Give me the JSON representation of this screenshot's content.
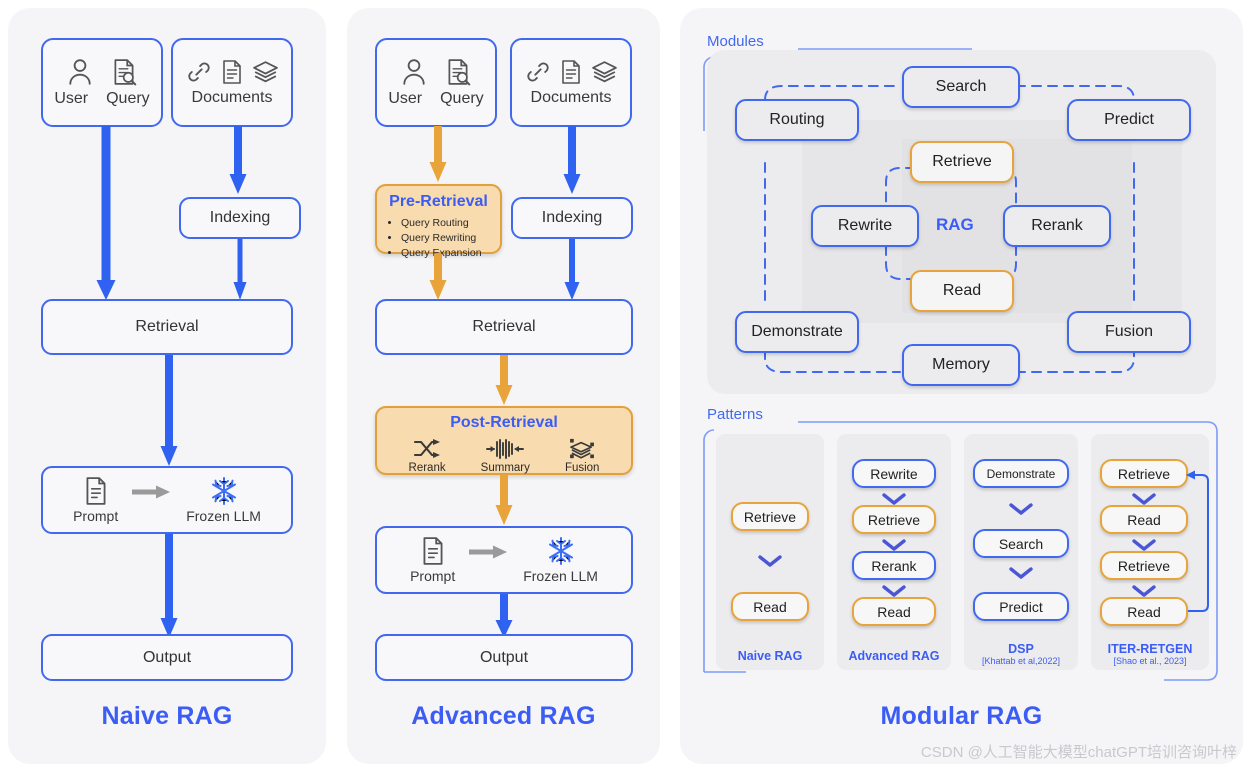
{
  "naive": {
    "title": "Naive RAG",
    "user_query": {
      "user": "User",
      "query": "Query"
    },
    "documents": "Documents",
    "indexing": "Indexing",
    "retrieval": "Retrieval",
    "prompt": "Prompt",
    "frozen_llm": "Frozen LLM",
    "output": "Output"
  },
  "advanced": {
    "title": "Advanced RAG",
    "user_query": {
      "user": "User",
      "query": "Query"
    },
    "documents": "Documents",
    "indexing": "Indexing",
    "pre_retrieval": {
      "header": "Pre-Retrieval",
      "items": [
        "Query Routing",
        "Query Rewriting",
        "Query Expansion"
      ]
    },
    "retrieval": "Retrieval",
    "post_retrieval": {
      "header": "Post-Retrieval",
      "items": [
        "Rerank",
        "Summary",
        "Fusion"
      ]
    },
    "prompt": "Prompt",
    "frozen_llm": "Frozen LLM",
    "output": "Output"
  },
  "modular": {
    "title": "Modular RAG",
    "modules_label": "Modules",
    "patterns_label": "Patterns",
    "rag_core_label": "RAG",
    "modules": {
      "search": "Search",
      "routing": "Routing",
      "predict": "Predict",
      "retrieve": "Retrieve",
      "rewrite": "Rewrite",
      "rerank": "Rerank",
      "read": "Read",
      "demonstrate": "Demonstrate",
      "fusion": "Fusion",
      "memory": "Memory"
    },
    "patterns": [
      {
        "name": "Naive RAG",
        "citation": "",
        "steps": [
          {
            "label": "Retrieve",
            "color": "orange"
          },
          {
            "label": "Read",
            "color": "orange"
          }
        ]
      },
      {
        "name": "Advanced RAG",
        "citation": "",
        "steps": [
          {
            "label": "Rewrite",
            "color": "blue"
          },
          {
            "label": "Retrieve",
            "color": "orange"
          },
          {
            "label": "Rerank",
            "color": "blue"
          },
          {
            "label": "Read",
            "color": "orange"
          }
        ]
      },
      {
        "name": "DSP",
        "citation": "[Khattab et al,2022]",
        "steps": [
          {
            "label": "Demonstrate",
            "color": "blue"
          },
          {
            "label": "Search",
            "color": "blue"
          },
          {
            "label": "Predict",
            "color": "blue"
          }
        ]
      },
      {
        "name": "ITER-RETGEN",
        "citation": "[Shao et al., 2023]",
        "steps": [
          {
            "label": "Retrieve",
            "color": "orange"
          },
          {
            "label": "Read",
            "color": "orange"
          },
          {
            "label": "Retrieve",
            "color": "orange"
          },
          {
            "label": "Read",
            "color": "orange"
          }
        ]
      }
    ]
  },
  "watermark": "CSDN @人工智能大模型chatGPT培训咨询叶梓",
  "colors": {
    "blue": "#3b5cf5",
    "border_blue": "#4169f0",
    "orange": "#e8a33d",
    "pre_retrieval_fill": "#f8dbae",
    "panel_bg": "#f5f5f7"
  }
}
